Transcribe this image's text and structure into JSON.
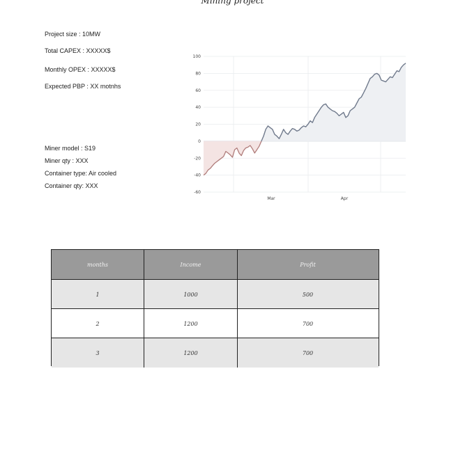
{
  "title": "Mining project",
  "info": {
    "project_size": "Project size : 10MW",
    "total_capex": "Total CAPEX : XXXXX$",
    "monthly_opex": "Monthly OPEX : XXXXX$",
    "expected_pbp": "Expected PBP : XX motnhs",
    "miner_model": "Miner model : S19",
    "miner_qty": "Miner qty : XXX",
    "container_type": "Container type: Air cooled",
    "container_qty": "Container qty: XXX"
  },
  "chart_data": {
    "type": "area",
    "title": "",
    "xlabel": "",
    "ylabel": "",
    "x_tick_labels": [
      "Mar",
      "Apr"
    ],
    "yticks": [
      100,
      80,
      60,
      40,
      20,
      0,
      -20,
      -40,
      -60
    ],
    "ylim": [
      -60,
      100
    ],
    "grid": true,
    "colors": {
      "line": "#707a8c",
      "positive_fill": "#eef0f3",
      "negative_fill": "#f4e4e3",
      "negative_line": "#b07c7a"
    },
    "series": [
      {
        "values": [
          -40,
          -38,
          -34,
          -32,
          -29,
          -26,
          -24,
          -22,
          -20,
          -18,
          -12,
          -14,
          -16,
          -19,
          -10,
          -8,
          -14,
          -17,
          -11,
          -8,
          -7,
          -5,
          -9,
          -14,
          -10,
          -6,
          0,
          6,
          14,
          18,
          16,
          14,
          8,
          6,
          3,
          8,
          14,
          10,
          8,
          12,
          15,
          14,
          12,
          13,
          16,
          18,
          17,
          20,
          24,
          22,
          28,
          32,
          36,
          40,
          43,
          44,
          40,
          38,
          36,
          35,
          33,
          30,
          32,
          34,
          28,
          30,
          36,
          38,
          40,
          45,
          50,
          52,
          57,
          62,
          68,
          74,
          76,
          79,
          80,
          78,
          72,
          71,
          70,
          73,
          76,
          75,
          79,
          83,
          82,
          87,
          90,
          92
        ]
      }
    ]
  },
  "table": {
    "headers": [
      "months",
      "Income",
      "Profit"
    ],
    "rows": [
      [
        "1",
        "1000",
        "500"
      ],
      [
        "2",
        "1200",
        "700"
      ],
      [
        "3",
        "1200",
        "700"
      ]
    ]
  }
}
